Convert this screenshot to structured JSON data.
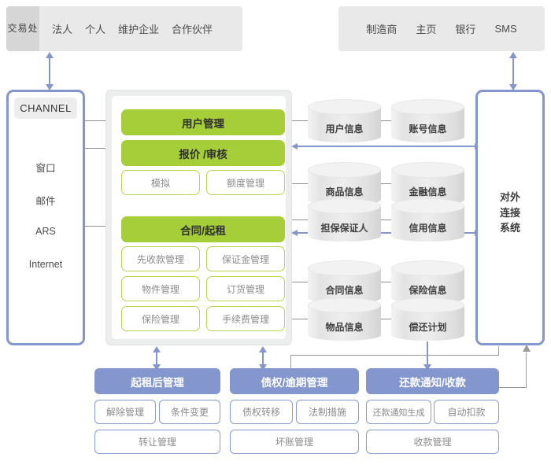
{
  "top_bars": [
    {
      "tag": "交易处",
      "items": [
        "法人",
        "个人",
        "维护企业",
        "合作伙伴"
      ]
    },
    {
      "tag": "",
      "items": [
        "制造商",
        "主页",
        "银行",
        "SMS"
      ]
    }
  ],
  "channel_panel": {
    "header": "CHANNEL",
    "items": [
      "窗口",
      "邮件",
      "ARS",
      "Internet"
    ]
  },
  "center_panel": {
    "blocks": [
      {
        "label": "用户管理",
        "style": "green"
      },
      {
        "label": "报价 /审核",
        "style": "green"
      }
    ],
    "quote_subitems": [
      "模拟",
      "额度管理"
    ],
    "contract_header": "合同/起租",
    "contract_subitems": [
      "先收款管理",
      "保证金管理",
      "物件管理",
      "订货管理",
      "保险管理",
      "手续费管理"
    ]
  },
  "databases": [
    {
      "label": "用户信息",
      "group": 1
    },
    {
      "label": "账号信息",
      "group": 1
    },
    {
      "label": "商品信息",
      "group": 2
    },
    {
      "label": "金融信息",
      "group": 2
    },
    {
      "label": "担保保证人",
      "group": 2
    },
    {
      "label": "信用信息",
      "group": 2
    },
    {
      "label": "合同信息",
      "group": 3
    },
    {
      "label": "保险信息",
      "group": 3
    },
    {
      "label": "物品信息",
      "group": 3
    },
    {
      "label": "偿还计划",
      "group": 3
    }
  ],
  "right_panel": {
    "label_lines": [
      "对外",
      "连接",
      "系统"
    ],
    "label": "对外连接系统"
  },
  "bottom_groups": [
    {
      "header": "起租后管理",
      "row1": [
        "解除管理",
        "条件变更"
      ],
      "row2": [
        "转让管理"
      ]
    },
    {
      "header": "债权/逾期管理",
      "row1": [
        "债权转移",
        "法制措施"
      ],
      "row2": [
        "坏账管理"
      ]
    },
    {
      "header": "还款通知/收款",
      "row1": [
        "还款通知生成",
        "自动扣款"
      ],
      "row2": [
        "收款管理"
      ]
    }
  ],
  "colors": {
    "green": "#a6ce39",
    "blue": "#8496ce",
    "bar_gray": "#e9e9e9",
    "tag_gray": "#d6d6d6",
    "panel_gray": "#eceded"
  }
}
